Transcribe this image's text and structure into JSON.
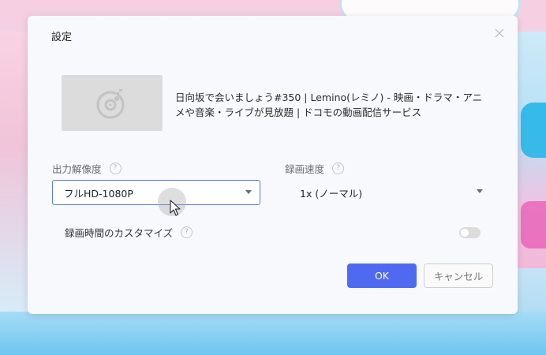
{
  "dialog": {
    "title": "設定",
    "video_title": "日向坂で会いましょう#350 | Lemino(レミノ) - 映画・ドラマ・アニメや音楽・ライブが見放題 | ドコモの動画配信サービス"
  },
  "resolution": {
    "label": "出力解像度",
    "selected": "フルHD-1080P"
  },
  "speed": {
    "label": "録画速度",
    "selected": "1x (ノーマル)"
  },
  "custom_time": {
    "label": "録画時間のカスタマイズ",
    "enabled": false
  },
  "buttons": {
    "ok": "OK",
    "cancel": "キャンセル"
  },
  "colors": {
    "accent": "#4f6af0",
    "select_border": "#5c78dd"
  },
  "icons": {
    "help": "?",
    "close": "×"
  }
}
